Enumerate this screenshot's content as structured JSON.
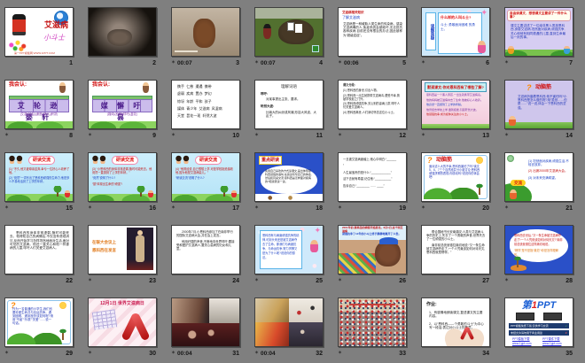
{
  "app": {
    "view": "slide-sorter",
    "background": "#7f7f7f",
    "slide_count": 35
  },
  "colors": {
    "accent_red": "#c41111",
    "accent_blue": "#1a3fc4",
    "label_text": "#161616"
  },
  "icons": {
    "animation_star": "animation-star",
    "ribbon": "aids-ribbon"
  },
  "slides": [
    {
      "n": "1",
      "star": false,
      "time": "",
      "t1": "艾滋病",
      "t2": "小斗士",
      "t3": "第一PPT模板网 WWW.1PPT.COM"
    },
    {
      "n": "2",
      "star": false,
      "time": ""
    },
    {
      "n": "3",
      "star": true,
      "time": "00:07"
    },
    {
      "n": "4",
      "star": true,
      "time": "00:07"
    },
    {
      "n": "5",
      "star": true,
      "time": "00:06",
      "t1": "艾滋病相关知识",
      "t2": "了解艾滋病",
      "t3": "艾滋病是一种威胁人类生命的传染病。感染艾滋病毒的人,免疫系统会被破坏,无法抵抗各种疾病,目前还没有根治的办法,因此被称为“超级癌症”。"
    },
    {
      "n": "6",
      "star": true,
      "time": "",
      "t1": "读题质疑",
      "t2": "什么样的人叫斗士?",
      "t3": "斗士: 勇敢面对困难 的勇士。"
    },
    {
      "n": "7",
      "star": true,
      "time": "",
      "t1": "自由读课文、想想课文主要讲了一件什么事?",
      "t2": "课文主要讲述了一位南非黑人男孩恩科西,身患艾滋病,坦然面对疾病,顽强抗争,关心和他有相同遭遇的儿童,直到生命最后一刻的事。"
    },
    {
      "n": "8",
      "star": true,
      "time": "",
      "t1": "我会认:",
      "t2": "艾 轮 逊 婴 轩",
      "t3": "(艾滋)(轮船)(谦逊)(婴儿)(轩昂)"
    },
    {
      "n": "9",
      "star": true,
      "time": "",
      "t1": "我会认:",
      "t2": "媒 懈 吁 昙",
      "t3": "(媒体)(松懈)(呼吁)(昙花)"
    },
    {
      "n": "10",
      "star": true,
      "time": "",
      "t1": "携手  仁慈  遭遇  携带",
      "t2": "虚弱  疾病  置办  梦幻",
      "t3": "惊讶  年龄  平和  孩子",
      "t4": "媒体  青少年  艾滋病  风湿病",
      "t5": "天堂  昙花一现  轩然大波"
    },
    {
      "n": "11",
      "star": true,
      "time": "",
      "t1": "理解词语",
      "t2": "呼吁:",
      "t3": "对某事提出主张、要求。",
      "t4": "轩然大波:",
      "t5": "比喻大的纠纷或风潮,形容大风波、大乱子。"
    },
    {
      "n": "12",
      "star": true,
      "time": "",
      "t1": "课文分段:",
      "t2": "(1) 恩科西的身世,引出人物。",
      "t3": "(2) 恩科西一出生就携带艾滋病毒,遭受不幸,曾被学校拒之门外。",
      "t4": "(3) 恩科西顽强抗争,关心别的患病儿童,呼吁人们关爱艾滋病人。",
      "t5": "(4) 恩科西离世,人们深切怀念这位小斗士。"
    },
    {
      "n": "13",
      "star": true,
      "time": "",
      "t1": "默读课文:你对恩科西有了哪些了解?",
      "t2": "恩科西是一个黑人男孩,一出生就携带艾滋病毒。",
      "t3": "他的妈妈被艾滋病夺去了生命,他被好心人收养。",
      "t4": "他竟然一直挺到了上学的年龄。",
      "t5": "他曾经去学校上学,遭到拒绝,引起轩然大波。",
      "t6": "他顽强抗争,成为媒体关注的小斗士。"
    },
    {
      "n": "14",
      "star": true,
      "time": "",
      "t1": "?",
      "t2": "动脑筋",
      "t3": "艾滋病折磨着恩科西,他不害怕吗?小恩科西是怎么做的呢?用“虽然……但是……”说一说,体会一下恩科西的坚强。"
    },
    {
      "n": "15",
      "star": true,
      "time": "",
      "t1": "研读交流",
      "t2": "(1) “不久,他又被母亲遗弃,幸亏一位好心人收养了他。”",
      "t3": "(2) “竟然”一词写出了恩科西顽强的生命力,他是多么不易地活到了上学的年龄。"
    },
    {
      "n": "16",
      "star": true,
      "time": "",
      "t1": "研读交流",
      "t2": "(3) “小恩科西的身体非常虚弱,随时可能死去。他竟然一直挺到了上学的年龄。”",
      "t3": "“竟然”说明了什么?",
      "t4": "“挺”体现出生命的“顽强”!"
    },
    {
      "n": "17",
      "star": true,
      "time": "",
      "t1": "研读交流",
      "t2": "(4) “他曾经说,自己很想上学,可是学校拒绝接收他,因为他是艾滋病患儿。”",
      "t3": "“研读交流”说明了什么?"
    },
    {
      "n": "18",
      "star": true,
      "time": "",
      "t1": "重点研读",
      "t2": "先用自己喜欢的方式读课文,画出体现恩科西顽强的语句,在旁边写写自己的体会,然后和同桌交流:恩科西是怎样面对疾病的?把感受读一读。"
    },
    {
      "n": "19",
      "star": true,
      "time": "",
      "t1": "一旦被艾滋病魔缠上,他心中明白:“______",
      "t2": "”",
      "t3": "人生最宝贵的是什么:“____________”",
      "t4": "活下去就有希望,记住他:“__________”",
      "t5": "告诉自己:“________ …… ____”"
    },
    {
      "n": "20",
      "star": true,
      "time": "",
      "t1": "?",
      "t2": "动脑筋",
      "t3": "面对这么大的不幸,恩科西害怕了吗?读文5、6、7三个自然段并分小组讨论:恩科西顽强拼搏的表现,你感动吗?说说你的体会吧!"
    },
    {
      "n": "21",
      "star": true,
      "time": "",
      "t1": "(1) 坦然面对疾病,顽强生活,不轻言放弃。",
      "t2": "(2) 出席2000年艾滋病大会。",
      "t3": "(3) 对未来充满希望。",
      "t4": "交流"
    },
    {
      "n": "22",
      "star": false,
      "time": "",
      "t1": "恩科西的身体非常虚弱,随时可能死去。他得知自己的病情后,不仅没有悲观消沉,反而开始学习怎样坦然地面对生活,面对可怕的艾滋病。他还一直关心和他一样患病的儿童,呼吁人们关爱艾滋病人。"
    },
    {
      "n": "23",
      "star": true,
      "time": "",
      "t1": "在联大会议上",
      "t2": "恩科西在发言"
    },
    {
      "n": "24",
      "star": false,
      "time": "",
      "t1": "2000年7月,小恩科西参加了在南非举行的国际艾滋病大会,并在会上发言。",
      "t2": "他用纤弱的声音,不断地向世界呼吁:要接受和爱护艾滋病人,要关心患病的妇女和儿童。"
    },
    {
      "n": "25",
      "star": true,
      "time": "",
      "t1": "恩科西有与病魔顽强抗争的精神,可到头来还是被艾滋病夺去了生命。那我们与病魔抗争、与命运抗争,努力拼搏又是为了什么呢?说说你的想法。"
    },
    {
      "n": "26",
      "star": true,
      "time": "",
      "t1": "2001年初,恩科西的病情开始恶化。6月1日,这个同艾滋病",
      "t2": "顽强抗争了12年的小斗士终于静静地离开了人世。"
    },
    {
      "n": "27",
      "star": false,
      "time": "",
      "t1": "联合国秘书长安南感叹:人类与艾滋病斗争的历史上,失去了一个勇敢的声音,世界失去了一位顽强的小斗士。",
      "t2": "南非前总统曼德拉痛切地说:“又一条生命被艾滋病夺走了,一个人究竟该如何对待天灾,恩科西就是榜样。”"
    },
    {
      "n": "28",
      "star": true,
      "time": "",
      "t1": "恩科西去世后,“又一条生命被艾滋病夺走了!一个人究竟该如何对待天灾?”南非前总统曼德拉这样痛切地说。",
      "t2": "“榜样”是不是指“典范”!你是怎样理解的。"
    },
    {
      "n": "29",
      "star": true,
      "time": "",
      "t1": "?",
      "t2": "作为一名普通的小学生,我们也要珍爱生命并与厄运抗争。遇到困难、遇到挫折该如何呢?请用“不屈”“乐观”“关爱”……说一句话。"
    },
    {
      "n": "30",
      "star": true,
      "time": "",
      "t1": "12月1日   世界艾滋病日"
    },
    {
      "n": "31",
      "star": true,
      "time": "00:04"
    },
    {
      "n": "32",
      "star": true,
      "time": "00:04"
    },
    {
      "n": "33",
      "star": true,
      "time": ""
    },
    {
      "n": "34",
      "star": false,
      "time": "",
      "t1": "作业:",
      "t2": "1、有感情地朗读课文,复述课文的主要内容。",
      "t3": "2、以“恩科西——个勇敢的斗士”为中心写一段话,表达对小斗士的敬意。"
    },
    {
      "n": "35",
      "star": false,
      "time": "",
      "t1": "第",
      "t2": "1",
      "t3": "PPT",
      "b1": "PPT模板免费下载,仅供学习交流",
      "b2": "未经允许请勿用于商业用途",
      "l1": "PPT模板下载",
      "l2": "www.1ppt.com",
      "l3": "PPT课件下载",
      "l4": "www.1ppt.com"
    }
  ]
}
